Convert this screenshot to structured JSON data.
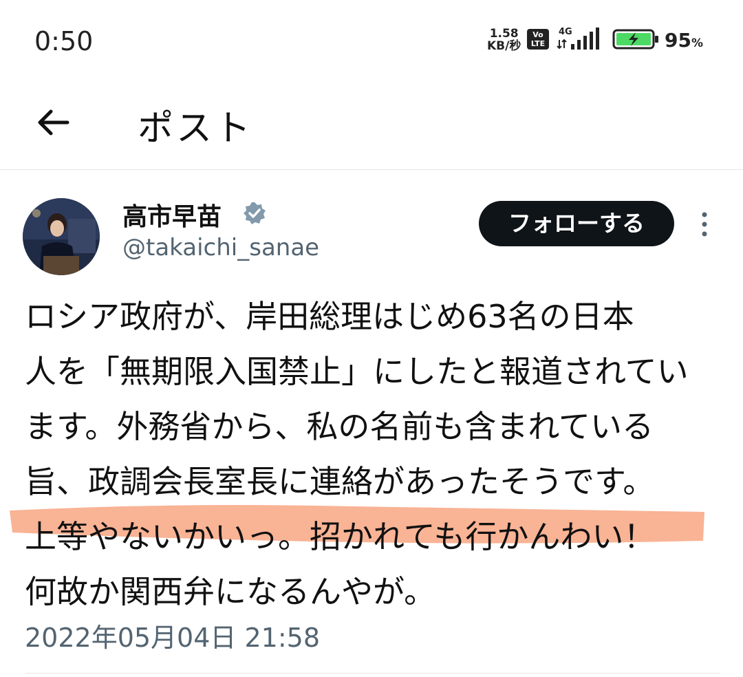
{
  "status_bar": {
    "time": "0:50",
    "net_speed_value": "1.58",
    "net_speed_unit": "KB/秒",
    "volte_label": "Vo LTE",
    "network_type": "4G",
    "battery_percent": "95",
    "battery_unit": "%"
  },
  "header": {
    "title": "ポスト"
  },
  "post": {
    "author_name": "高市早苗",
    "author_handle": "@takaichi_sanae",
    "follow_label": "フォローする",
    "body_lines": [
      "ロシア政府が、岸田総理はじめ63名の日本",
      "人を「無期限入国禁止」にしたと報道されてい",
      "ます。外務省から、私の名前も含まれている",
      "旨、政調会長室長に連絡があったそうです。",
      "上等やないかいっ。招かれても行かんわい！",
      "何故か関西弁になるんやが。"
    ],
    "timestamp": "2022年05月04日 21:58"
  },
  "colors": {
    "highlight": "#f7a07a",
    "follow_bg": "#0f1419",
    "secondary_text": "#536471"
  }
}
